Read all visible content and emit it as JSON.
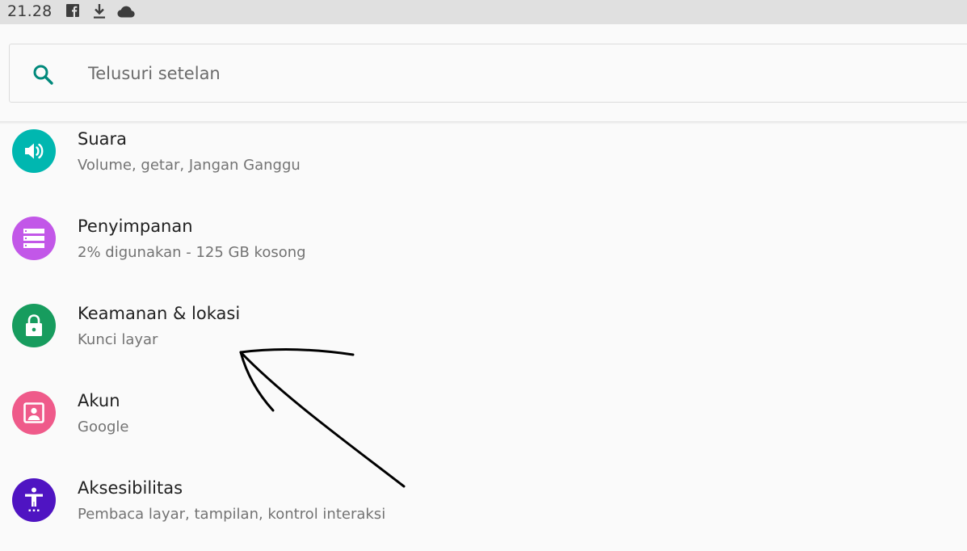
{
  "status_bar": {
    "time": "21.28",
    "icons": [
      "facebook-icon",
      "download-icon",
      "cloud-icon"
    ]
  },
  "search": {
    "placeholder": "Telusuri setelan",
    "icon": "search-icon"
  },
  "colors": {
    "accent": "#00897b",
    "sound": "#00b7b0",
    "storage": "#c257e8",
    "security": "#179c5e",
    "accounts": "#ef5a8a",
    "accessibility": "#4f14c2"
  },
  "settings": [
    {
      "title": "Suara",
      "subtitle": "Volume, getar, Jangan Ganggu",
      "icon": "volume-icon"
    },
    {
      "title": "Penyimpanan",
      "subtitle": "2% digunakan - 125 GB kosong",
      "icon": "storage-icon"
    },
    {
      "title": "Keamanan & lokasi",
      "subtitle": "Kunci layar",
      "icon": "lock-icon"
    },
    {
      "title": "Akun",
      "subtitle": "Google",
      "icon": "account-icon"
    },
    {
      "title": "Aksesibilitas",
      "subtitle": "Pembaca layar, tampilan, kontrol interaksi",
      "icon": "accessibility-icon"
    }
  ]
}
